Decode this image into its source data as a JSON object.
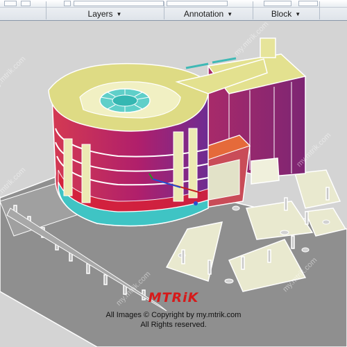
{
  "ribbon": {
    "panels": [
      {
        "label": "Layers"
      },
      {
        "label": "Annotation"
      },
      {
        "label": "Block"
      }
    ]
  },
  "viewport": {
    "watermark_text": "my.mtrik.com",
    "logo_text": "MTRiK",
    "copyright_line1": "All Images © Copyright by my.mtrik.com",
    "copyright_line2": "All Rights reserved."
  },
  "colors": {
    "roof": "#e6e49a",
    "facade_magenta": "#b0206a",
    "facade_purple": "#7a2a8c",
    "band_red": "#d3213d",
    "band_teal": "#38c7c7",
    "plaza_cream": "#eeeed2",
    "ground": "#9a9a9a"
  }
}
